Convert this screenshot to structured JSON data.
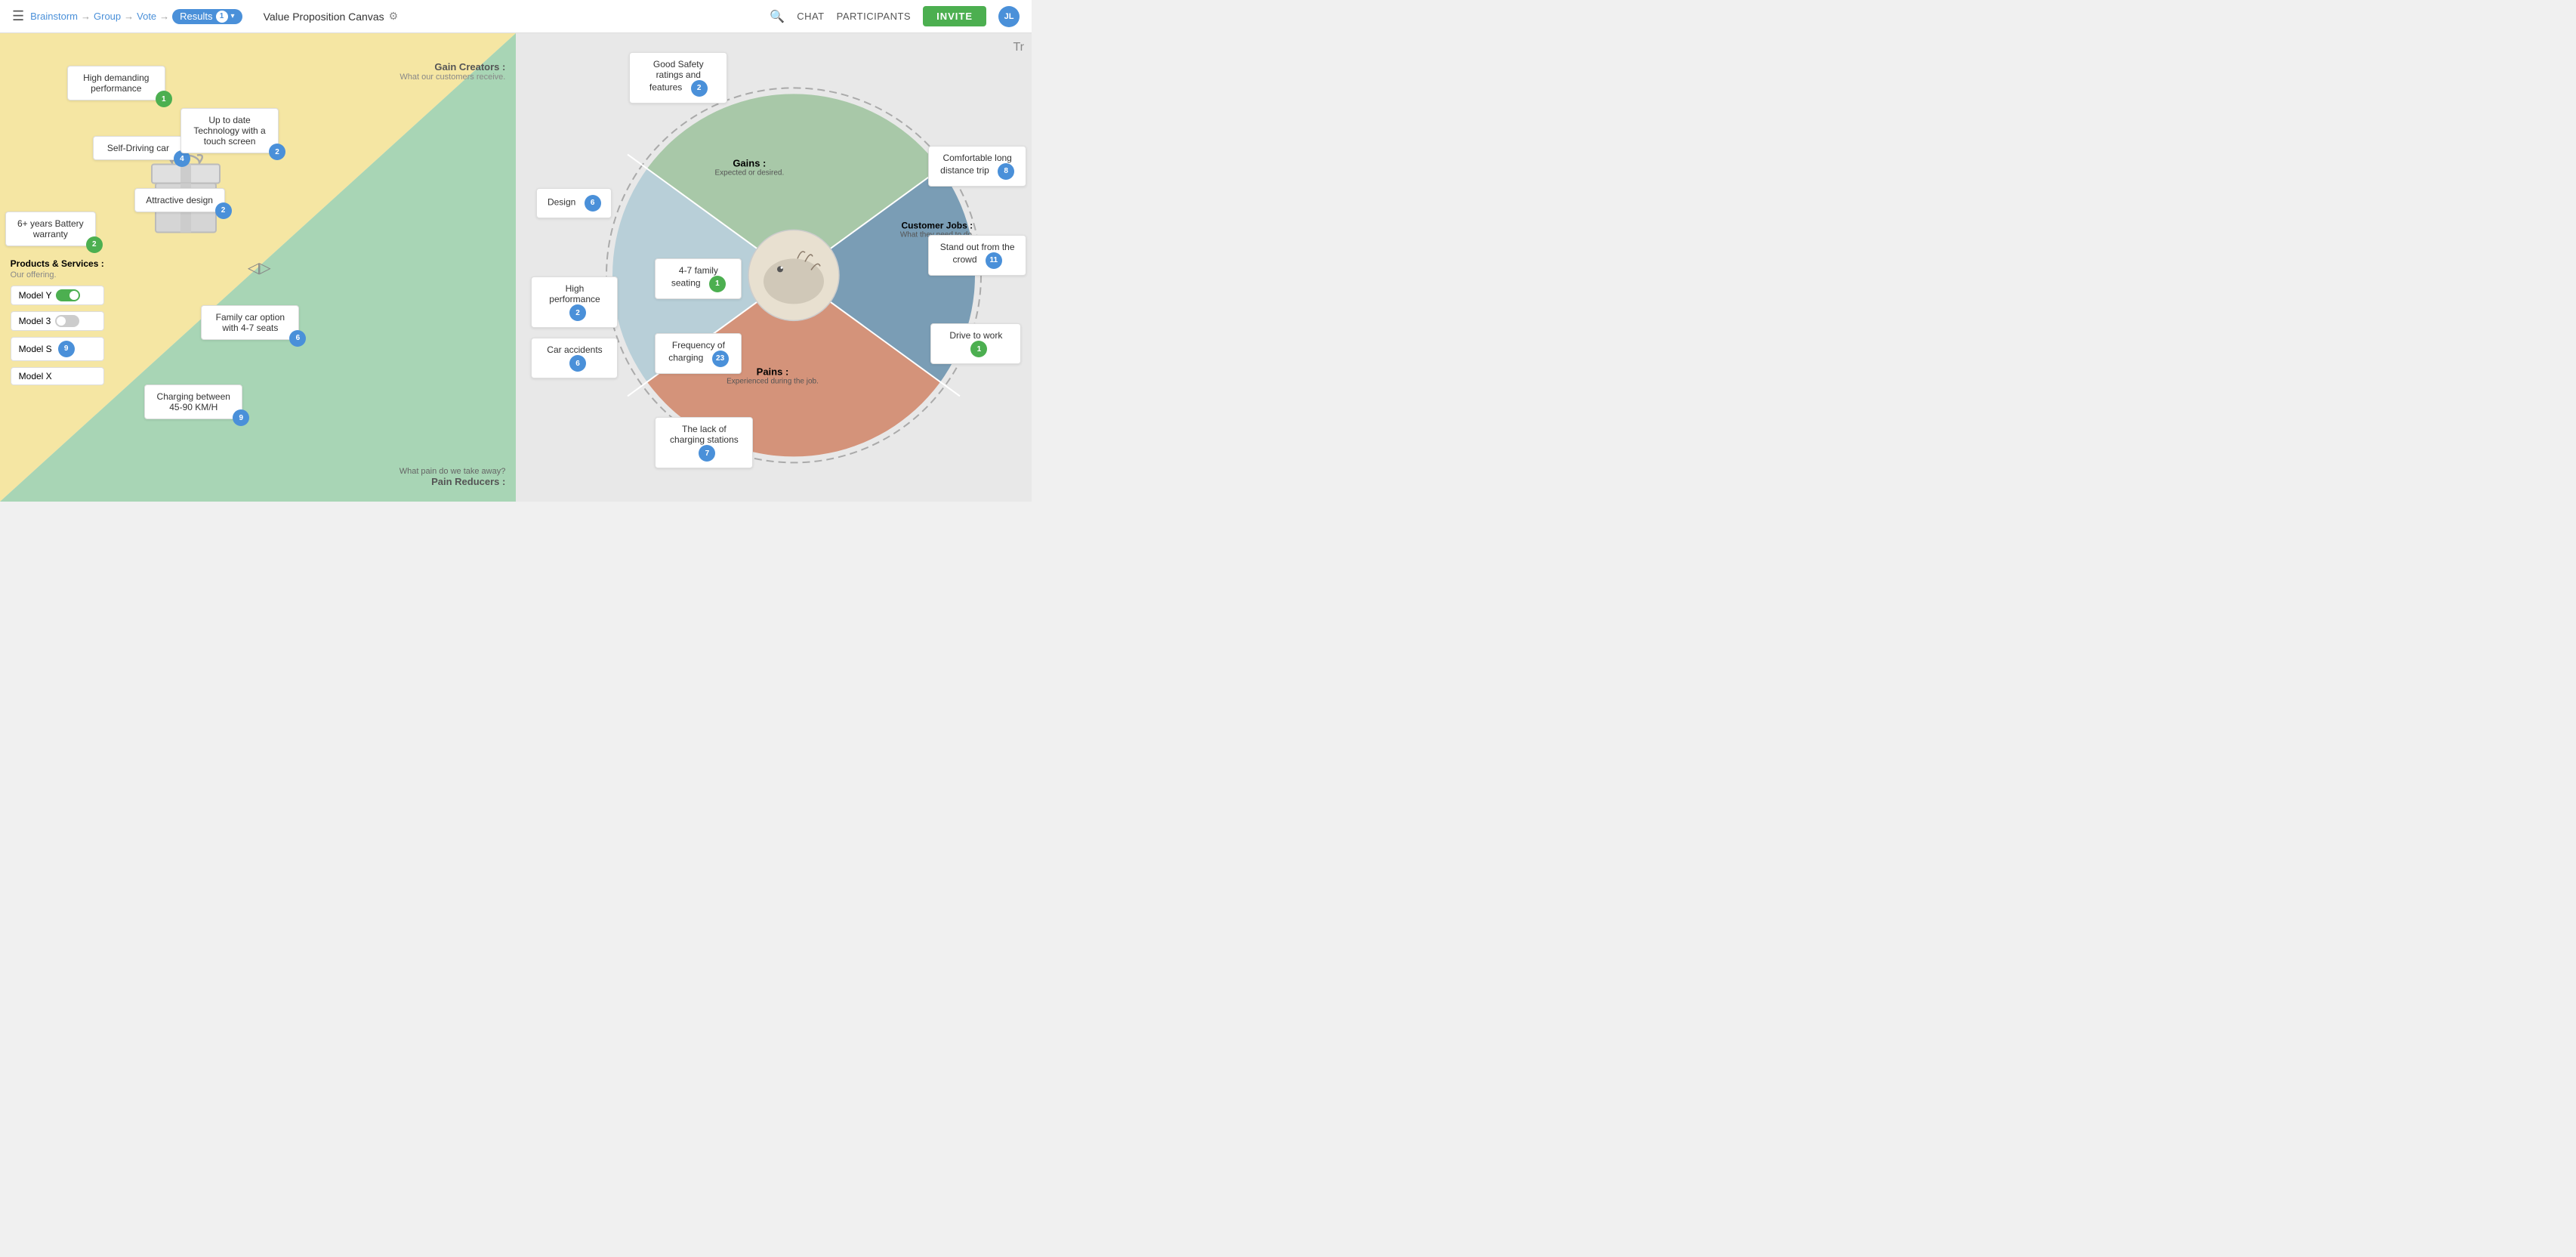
{
  "header": {
    "menu_icon": "☰",
    "breadcrumb": {
      "brainstorm": "Brainstorm",
      "group": "Group",
      "vote": "Vote",
      "results": "Results",
      "results_count": "1"
    },
    "canvas_title": "Value Proposition Canvas",
    "gear_icon": "⚙",
    "search_icon": "🔍",
    "chat_label": "CHAT",
    "participants_label": "PARTICIPANTS",
    "invite_label": "INVITE",
    "avatar_text": "JL",
    "tr_icon": "Tr"
  },
  "left_panel": {
    "gain_creators_title": "Gain Creators :",
    "gain_creators_sub": "What our customers receive.",
    "products_title": "Products & Services :",
    "products_sub": "Our offering.",
    "pain_reducers_title": "Pain Reducers :",
    "pain_question": "What pain do we take away?",
    "cards": {
      "high_demanding": {
        "text": "High demanding performance",
        "vote": "1",
        "vote_color": "green"
      },
      "self_driving": {
        "text": "Self-Driving car",
        "vote": "4",
        "vote_color": "blue"
      },
      "up_to_date": {
        "text": "Up to date Technology with a touch screen",
        "vote": "2",
        "vote_color": "blue"
      },
      "attractive": {
        "text": "Attractive design",
        "vote": "2",
        "vote_color": "blue"
      },
      "battery": {
        "text": "6+ years Battery warranty",
        "vote": "2",
        "vote_color": "green"
      },
      "family_car": {
        "text": "Family car option with 4-7 seats",
        "vote": "6",
        "vote_color": "blue"
      },
      "charging": {
        "text": "Charging between 45-90 KM/H",
        "vote": "9",
        "vote_color": "blue"
      }
    },
    "products": {
      "model_y": {
        "name": "Model Y",
        "on": true
      },
      "model_3": {
        "name": "Model 3",
        "on": false
      },
      "model_s": {
        "name": "Model S",
        "vote": "9",
        "vote_color": "blue"
      },
      "model_x": {
        "name": "Model X"
      }
    }
  },
  "right_panel": {
    "gains_title": "Gains :",
    "gains_sub": "Expected or desired.",
    "pains_title": "Pains :",
    "pains_sub": "Experienced during the job.",
    "customer_jobs_title": "Customer Jobs :",
    "customer_jobs_sub": "What they need to do.",
    "cards": {
      "good_safety": {
        "text": "Good Safety ratings and features",
        "vote": "2",
        "vote_color": "blue"
      },
      "design": {
        "text": "Design",
        "vote": "6",
        "vote_color": "blue"
      },
      "high_performance": {
        "text": "High performance",
        "vote": "2",
        "vote_color": "blue"
      },
      "family_seating": {
        "text": "4-7 family seating",
        "vote": "1",
        "vote_color": "green"
      },
      "car_accidents": {
        "text": "Car accidents",
        "vote": "6",
        "vote_color": "blue"
      },
      "frequency": {
        "text": "Frequency of charging",
        "vote": "23",
        "vote_color": "blue"
      },
      "lack_charging": {
        "text": "The lack of charging stations",
        "vote": "7",
        "vote_color": "blue"
      },
      "comfortable": {
        "text": "Comfortable long distance trip",
        "vote": "8",
        "vote_color": "blue"
      },
      "stand_out": {
        "text": "Stand out from the crowd",
        "vote": "11",
        "vote_color": "blue"
      },
      "drive_work": {
        "text": "Drive to work",
        "vote": "1",
        "vote_color": "green"
      }
    }
  }
}
